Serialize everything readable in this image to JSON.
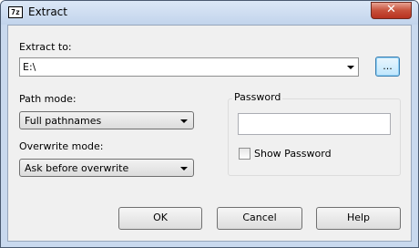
{
  "window": {
    "title": "Extract",
    "app_icon_text": "7z",
    "close_icon": "close-icon"
  },
  "extract_to": {
    "label": "Extract to:",
    "value": "E:\\",
    "browse_label": "..."
  },
  "path_mode": {
    "label": "Path mode:",
    "value": "Full pathnames"
  },
  "overwrite_mode": {
    "label": "Overwrite mode:",
    "value": "Ask before overwrite"
  },
  "password": {
    "group_label": "Password",
    "value": "",
    "show_password_label": "Show Password",
    "show_password_checked": false
  },
  "buttons": {
    "ok": "OK",
    "cancel": "Cancel",
    "help": "Help"
  }
}
